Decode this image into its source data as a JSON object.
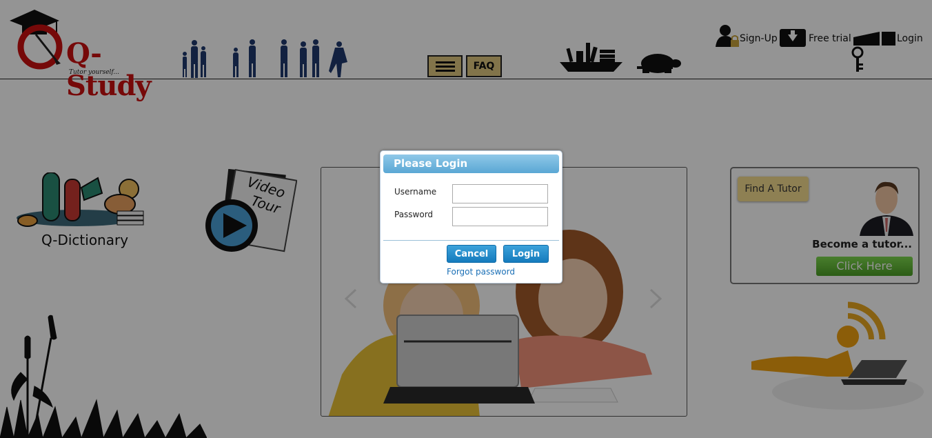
{
  "header": {
    "logo_text": "Q-Study",
    "logo_tagline": "Tutor yourself...",
    "faq_label": "FAQ",
    "signup_label": "Sign-Up",
    "free_trial_label": "Free trial",
    "login_label": "Login"
  },
  "features": {
    "dictionary_label": "Q-Dictionary",
    "video_tour_line1": "Video",
    "video_tour_line2": "Tour"
  },
  "tutor_box": {
    "find_tutor_label": "Find A Tutor",
    "become_tutor_text": "Become a tutor...",
    "click_here_label": "Click Here"
  },
  "login_modal": {
    "title": "Please Login",
    "username_label": "Username",
    "password_label": "Password",
    "username_value": "",
    "password_value": "",
    "cancel_label": "Cancel",
    "login_label": "Login",
    "forgot_password_label": "Forgot password"
  },
  "colors": {
    "logo_red": "#cc1111",
    "button_gold": "#e0c880",
    "modal_blue": "#5aa7d4",
    "action_blue": "#157bbd",
    "click_here_green": "#4c9f26",
    "overlay": "rgba(0,0,0,0.42)"
  }
}
